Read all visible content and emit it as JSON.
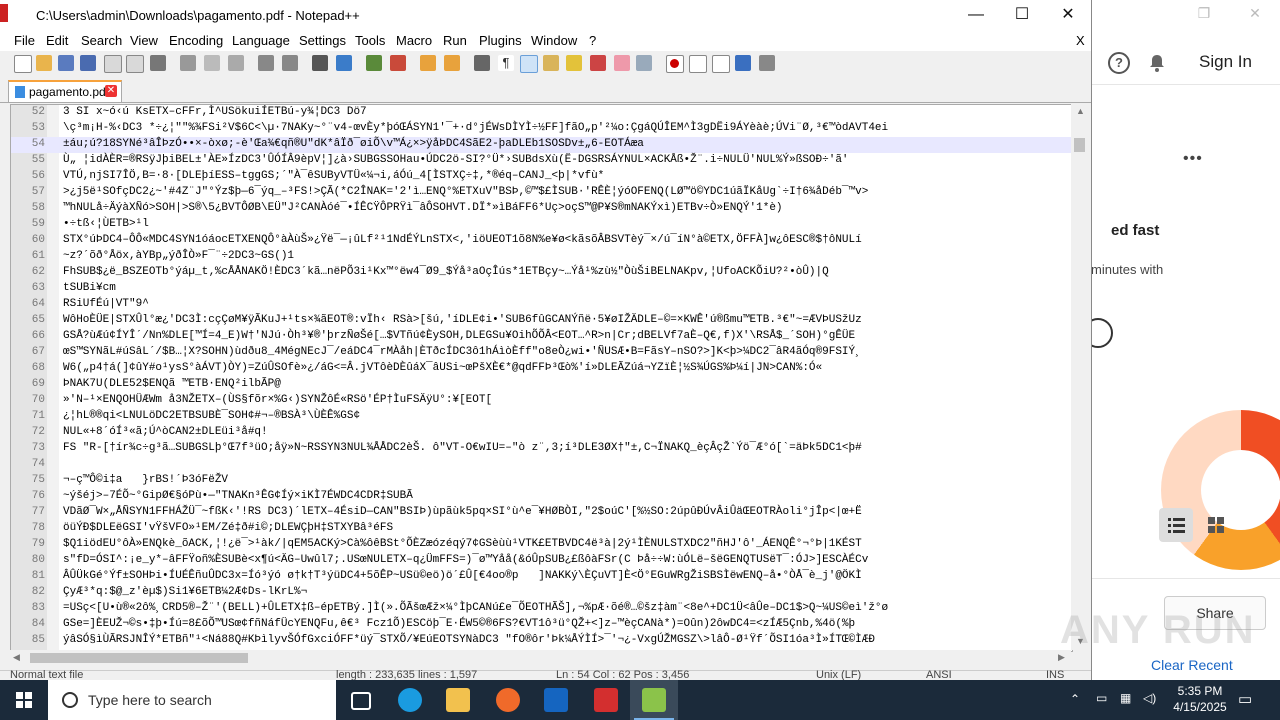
{
  "window": {
    "title": "C:\\Users\\admin\\Downloads\\pagamento.pdf - Notepad++",
    "minimize": "—",
    "maximize": "☐",
    "close": "✕",
    "menu_close": "X"
  },
  "menu": [
    "File",
    "Edit",
    "Search",
    "View",
    "Encoding",
    "Language",
    "Settings",
    "Tools",
    "Macro",
    "Run",
    "Plugins",
    "Window",
    "?"
  ],
  "tab": {
    "label": "pagamento.pdf"
  },
  "editor": {
    "lines": [
      {
        "n": "52",
        "t": "3 SI x~ó‹ú KsETX–cFFr,Ì^USökuiÍETBú-y¾¦DC3 Dö7"
      },
      {
        "n": "53",
        "t": "\\ç³m¡H-%‹DC3 *÷¿¦\"\"%¾FSi²V$6C<\\µ·7NAKy~°¨v4-œvÈy*þóŒÁSYN1'¯+·d°jÉWsDÌYÌ÷½FF]fãO„p'²¼o:ÇgáQÚÎEM^Ì3gDËi9ÁYèàè;ÚVi¨Ø,³€™òdAVT4ei"
      },
      {
        "n": "54",
        "t": "±áu;ú?18SYNé³âÎÞzÓ••×-òxø;-è'Œa¾€qñ®U\"dK*âÏð¯øiÕ\\v™Á¿×>ÿåÞDC4SãE2-þaDLEb1SOSDv±„6-EOTÁæa"
      },
      {
        "n": "55",
        "t": "Ù„ ¦idÀÈR=®RSÿJþiBEL±'ÀE»ÍzDC3'ÛÓÍÂ9èpV¦]¿à›SUBGSSOHau•ÚDC2ö-SI?°Ü*›SUBdsXù(Ë-DGSRSÁYNUL×ACKÅß•Ž¨.i÷NULÜ'NUL%Ý»ßSOÐ÷'ã'"
      },
      {
        "n": "56",
        "t": "VTÚ,njSI7ÎÖ,B=·8·[DLEþíESS–tggGS;´\"À¯êSUByVTÜ«¼¬i,áÓú_4[ÌSTXÇ÷‡,*®éq–CANJ_<þ|*vfù*"
      },
      {
        "n": "57",
        "t": ">¿j5ë¹SOfçDC2¿~'#4Z¨J\"°Ýz$þ—6¯ýq_–³FS!>ÇÃ(*C2ÎNAK='2'ì…ENQ°%ETXuV\"BSÞ,©™$£ÌSUB·'RÊÈ¦ýóOFENQ(LØ™ö©YDC1úãÏKåUg`÷I†6¾åDéb¯™v>"
      },
      {
        "n": "58",
        "t": "™hNULå÷ÄýàXÑó>SOH|>S®\\5¿BVTÔØB\\EÜ\"J²CANÀóé¯•ÍÊCŸÔPRŸì¯âÔSOHVT.DÏ*»ìBáFF6*Uç>oçS™@P¥S®mNAKÝxì)ETBv÷Ò»ENQÝ'1*è)"
      },
      {
        "n": "59",
        "t": "•÷tß‹¦ÙETB>¹l"
      },
      {
        "n": "60",
        "t": "STX°úÞDC4–ÔÔ«MDC4SYN1óáocETXENQÔ°àÀùŠ»¿Ÿë¯—¡ûLf²¹1NdÉÝLnSTX<,'iöUEOT1õ8N%e¥ø<kãsõÂBSVTèý¯×/ú¯íN°à©ETX,ÖFFÀ]w¿ôESC®$†ôNULí"
      },
      {
        "n": "61",
        "t": "~z?´õð°Åöx,àYBp„ýðÎÒ»F¯¨÷2DC3~GS()1"
      },
      {
        "n": "62",
        "t": "FhSUB$¿ë_BSZEOTb°ýáµ_t‚%cÅÅNAKÖ!ÈDC3´kã…nëPÕ3i¹Kx™°ëw4¯Ø9_$Ýå³aOçÎús*1ETBçy~…Ýå¹%zù½\"ÒùŠiBELNAKpv,¦UfoACKÕiU?²•òÛ)|Q"
      },
      {
        "n": "63",
        "t": "tSUBi¥cm"
      },
      {
        "n": "64",
        "t": "RSiUfÉú|VT\"9^"
      },
      {
        "n": "65",
        "t": "WôHoÈÜE|STXÛl°æ¿'DC3Ì:cçÇøM¥ÿÃKuJ+¹ts×¾ãEOT®:vÏh‹ RSà>[šú,'íDLE¢i•'SUB6fûGCANÝñë·5¥øIŽÄDLE–©=×KWÊ'ú®ßmu™ETB.³€\"~=ÆVÞUSžUz"
      },
      {
        "n": "66",
        "t": "GSÅ?ùÆú¢ÍYÎ´/Nn%DLE[™Í=4_E)W†'NJú·Òh³¥®'þrzÑøŠé[…$VTñú¢ÈySOH,DLEGSu¥OihÕÕÂ<EOT…^R>n|Cr;dBELVf7aÈ–Q€,f)X'\\RSÅ$_´SOH)°gÊÜE"
      },
      {
        "n": "67",
        "t": "œS™SYNãL#úSâL´/$B…¦X?SOHN)ùdðu8_4MégNEcJ¯/eáDC4¯rMÀåh|ÈTðcÍDC3ô1hÁìòÈff\"o8eÒ¿wi•'ÑUSÆ•B=FãsY–nSO?>]K<þ>¼DC2¯âR4ãÓq®9FSIÝ¸"
      },
      {
        "n": "68",
        "t": "W6(„p4†á(]¢ûY#o¹ysS°àÁVT)ÒY)=ZúÛSOfè»¿/áG<=Â.jVTôèDÈûáX¯âUSi~œPšXÈ€*@qdFFÞ³Œò%'í»DLEÃZúá¬YZïÈ¦½S¾ÚGS%Þ¼í|JN>CAN%:Ó«"
      },
      {
        "n": "69",
        "t": "ÞNAK7U(DLE52$ENQã ™ETB·ENQ²ilbÃP@"
      },
      {
        "n": "70",
        "t": "»'N–¹×ENQOHÜÆWm å3NŽETX–(ÙS§fõr×%G‹)SYNŽôÉ«RSö'ÉP†ÌuFSÄÿU°:¥[EOT["
      },
      {
        "n": "71",
        "t": "¿¦hL®®qi<LNULöDC2ETBSUBÈ¯SOH¢#¬–®BSÀ³\\ÙÈÊ%GS¢"
      },
      {
        "n": "72",
        "t": "NUL«+8´óÍ³«ã;Ú^òCAN2±DLEüi³å#q!"
      },
      {
        "n": "73",
        "t": "FS \"R-[†ír¾c÷g³ã…SUBGSLþ°Œ7f³üO;åÿ»N~RSSYN3NUL¾ÅÅDC2èŠ. ô\"VT-O€wIU=–\"ò z¨,3;í³DLE3ØX†\"±,C¬ÏNAKQ_èçÂçŽ`Ýö¯Æ°ó[`=äÞk5DC1<þ#"
      },
      {
        "n": "74",
        "t": ""
      },
      {
        "n": "75",
        "t": "¬–ç™Ô©i‡a   }rBS!´Þ3óFëŽV"
      },
      {
        "n": "76",
        "t": "~ýšéj>–7ÉÕ~°GipØ€§óPù•—\"TNAKn³ÊG¢Íý×iKÌ7ÉWDC4CDR‡SUBÃ"
      },
      {
        "n": "77",
        "t": "VDãØ¯W×„ÅÑSYN1FFHÁŽÜ¯~fßK‹'!RS DC3)´lETX–4ÉsiD—CAN\"BSIÞ)ùpãùk5pq×SI°ù^e¯¥HØBÒI,\"2$oúC'[%½SO:2úpûÐÚvÂiÛäŒEOTRÀoli°jÎp<|œ+Ë"
      },
      {
        "n": "78",
        "t": "öüÝÐ$DLEëGSI'vŸšVFO»¹EM/Zé‡ð#i©;DLEWÇþH‡STXYBâ³éFS"
      },
      {
        "n": "79",
        "t": "$Q1iödEU°ôÀ»ENQkè_õACK,¦!¿ë¯>¹àk/|qEM5ACKý>Cà%ôêBSt°ÕÈZæózéqý7¢GSèùù¹VTK£ETBVDC4ë³à|2ý¹ÌÈNULSTXDC2\"ñHJ'ô'_ÁENQÊ°¬°Þ|1KÉST"
      },
      {
        "n": "80",
        "t": "s\"fD=ÓSI^:¡e_y*–âFFŸoñ%ÈSUBè<x¶ú<ÄG–Uwûl7;.USœNULETX–q¿ÜmFFS=)¯ø™Yåå(&óÛpSUB¿£ßôàFSr(C Þå÷÷W:ùÓLë–šëGENQTUSëT¯:ÓJ>]ESCÀÉCv"
      },
      {
        "n": "81",
        "t": "ÂÛÜkGé°Ýf±SOHÞi•ÍUÉÊñuÛDC3x=Íó³ýó ø†k†T³ýüDC4+5õÊP~USü©eö)ö´£Û[€4oo®p   ]NAKKý\\ÈÇuVT]È<Ö°EGuWRgŽiSBSÌëwENQ–å•°ÒÅ¯è_j'@ÖKÌ"
      },
      {
        "n": "82",
        "t": "ÇyÆ³*q:$@_z'èµ$)Si1¥6ETB¼2Æ¢Ds-lKrL%¬"
      },
      {
        "n": "83",
        "t": "=USç<[U•ù®«2ô%¸CRD5®–Ž¨'(BELL)+ÛLETX‡ß–épETBý.]Ì(».ÕÃšœÆž×¼°ÌþCANú£e¯ÕEOTHÃŠ],¬%pÆ·õé®…©šz‡àm¨<8e^+DC1Ü<âÛe–DC1$>Q~¼US©eì'ž°ø"
      },
      {
        "n": "84",
        "t": "GSe=]ÈEUŽ¬©s•‡þ•Íú=8£õÕ™USœ¢fñNáfÜcYENQFu,ê€³ Fcz1Õ)ESCöþ¯E·ÉW5©®6FS?€VT1ô³ü°QŽ+<]z–™èçCANà*)=Oûn)2ôwDC4=<zÍÆ5Çnb,%4ö(%þ"
      },
      {
        "n": "85",
        "t": "ýâSÓ§ìÙÃRSJNÎÝ*ETBñ\"¹<Ná88Q#KÞìlyvŠÓfGxciÓFF*üý¯STXÕ/¥EúEOTSYNàDC3 \"fO®ôr'Þk¼ÅÝÌÍ>¯'¬¿-VxgÚŽMGSZ\\>lâÔ-Ø¹Ÿf´ÕSI1óa³Ì»ÍTŒ©ÌÆÐ"
      }
    ]
  },
  "statusbar": {
    "type": "Normal text file",
    "length": "length : 233,635   lines : 1,597",
    "position": "Ln : 54   Col : 62   Pos : 3,456",
    "eol": "Unix (LF)",
    "encoding": "ANSI",
    "mode": "INS"
  },
  "background_app": {
    "sign_in": "Sign In",
    "headline": "ed fast",
    "subtext": "minutes with",
    "share": "Share",
    "clear_recent": "Clear Recent"
  },
  "taskbar": {
    "search_placeholder": "Type here to search",
    "time": "5:35 PM",
    "date": "4/15/2025"
  },
  "watermark": "ANY RUN"
}
